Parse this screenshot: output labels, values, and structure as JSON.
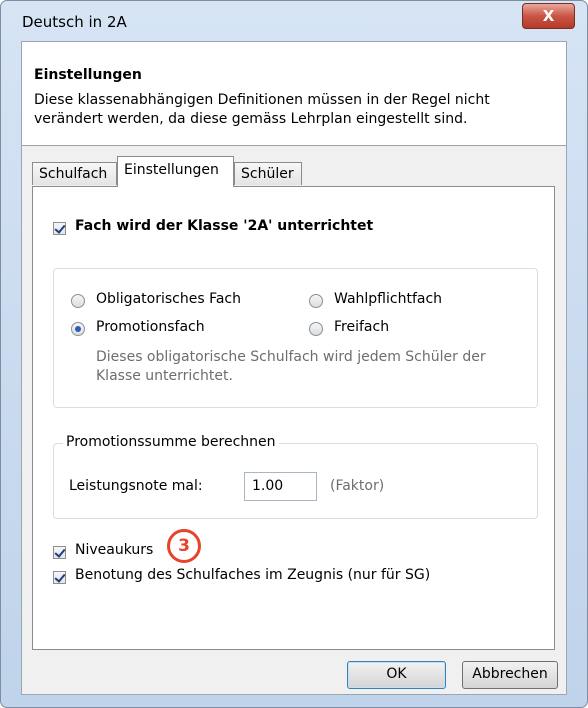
{
  "window": {
    "title": "Deutsch in 2A",
    "close_glyph": "X"
  },
  "header": {
    "title": "Einstellungen",
    "description": "Diese klassenabhängigen Definitionen müssen in der Regel nicht verändert werden, da diese gemäss Lehrplan eingestellt sind."
  },
  "tabs": [
    {
      "label": "Schulfach",
      "active": false
    },
    {
      "label": "Einstellungen",
      "active": true
    },
    {
      "label": "Schüler",
      "active": false
    }
  ],
  "panel": {
    "taught_checkbox": {
      "label": "Fach wird der Klasse '2A' unterrichtet",
      "checked": true
    },
    "subject_type": {
      "options": [
        {
          "label": "Obligatorisches Fach",
          "selected": false
        },
        {
          "label": "Wahlpflichtfach",
          "selected": false
        },
        {
          "label": "Promotionsfach",
          "selected": true
        },
        {
          "label": "Freifach",
          "selected": false
        }
      ],
      "hint": "Dieses obligatorische Schulfach wird jedem Schüler der Klasse unterrichtet."
    },
    "promotion_group": {
      "title": "Promotionssumme berechnen",
      "field_label": "Leistungsnote mal:",
      "value": "1.00",
      "suffix": "(Faktor)"
    },
    "niveau_checkbox": {
      "label": "Niveaukurs",
      "checked": true
    },
    "grading_checkbox": {
      "label": "Benotung des Schulfaches im Zeugnis (nur für SG)",
      "checked": true
    },
    "callout": "3"
  },
  "buttons": {
    "ok": "OK",
    "cancel": "Abbrechen"
  },
  "colors": {
    "accent": "#2a5db8",
    "callout": "#e8432b",
    "close": "#c95545"
  }
}
